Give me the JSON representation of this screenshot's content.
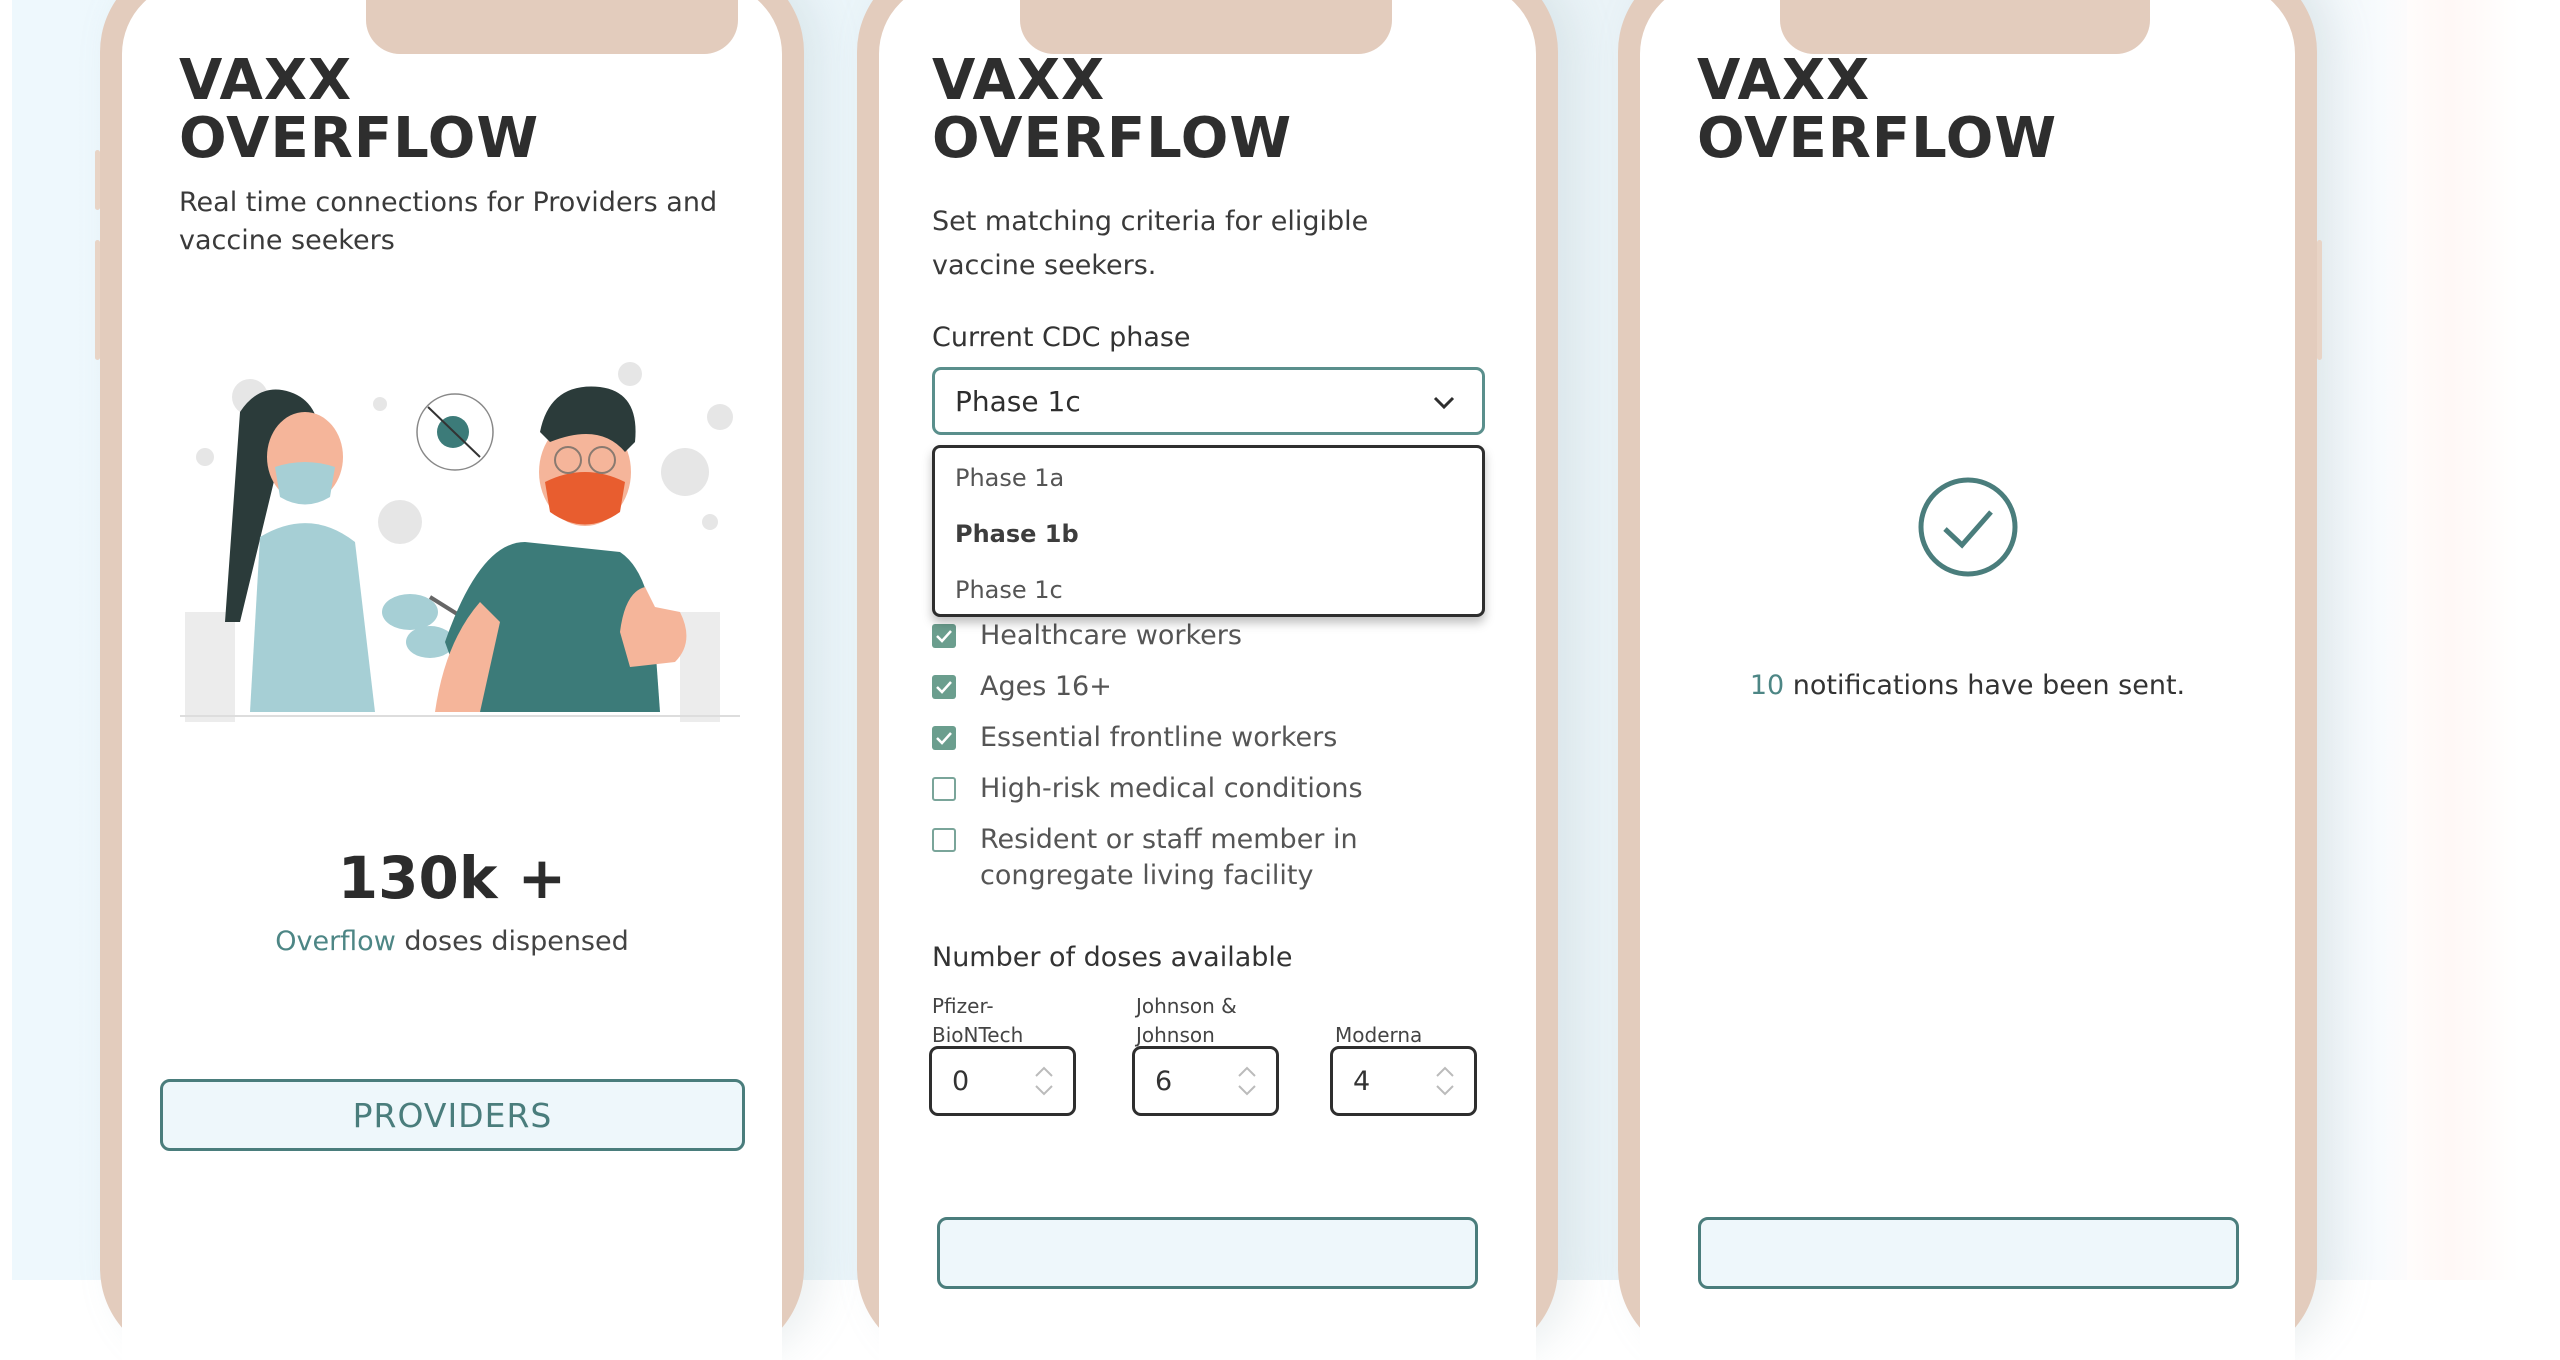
{
  "brand": {
    "line1": "VAXX",
    "line2": "OVERFLOW"
  },
  "colors": {
    "accent": "#4a7d7c",
    "frame": "#e3ccbd",
    "checkbox": "#6b9e8e",
    "button_bg": "#eef7fb"
  },
  "screens": {
    "landing": {
      "tagline": "Real time connections for Providers and vaccine seekers",
      "illustration": "nurse-vaccinating-patient-illustration",
      "stat_number": "130k +",
      "stat_caption_accent": "Overflow",
      "stat_caption_rest": " doses dispensed",
      "providers_button": "PROVIDERS"
    },
    "criteria": {
      "intro": "Set matching criteria for eligible vaccine seekers.",
      "phase_label": "Current CDC phase",
      "phase_selected": "Phase 1c",
      "phase_options": [
        "Phase 1a",
        "Phase 1b",
        "Phase 1c"
      ],
      "phase_highlighted": "Phase 1b",
      "criteria": [
        {
          "label": "Healthcare workers",
          "checked": true
        },
        {
          "label": "Ages 16+",
          "checked": true
        },
        {
          "label": "Essential frontline workers",
          "checked": true
        },
        {
          "label": "High-risk medical conditions",
          "checked": false
        },
        {
          "label": "Resident or staff member in congregate living facility",
          "checked": false
        }
      ],
      "doses_label": "Number of doses available",
      "vendors": [
        {
          "name": "Pfizer-BioNTech",
          "line1": "Pfizer-",
          "line2": "BioNTech",
          "value": "0"
        },
        {
          "name": "Johnson & Johnson",
          "line1": "Johnson &",
          "line2": "Johnson",
          "value": "6"
        },
        {
          "name": "Moderna",
          "line1": "",
          "line2": "Moderna",
          "value": "4"
        }
      ]
    },
    "confirmation": {
      "count": "10",
      "message": " notifications have been sent."
    }
  }
}
